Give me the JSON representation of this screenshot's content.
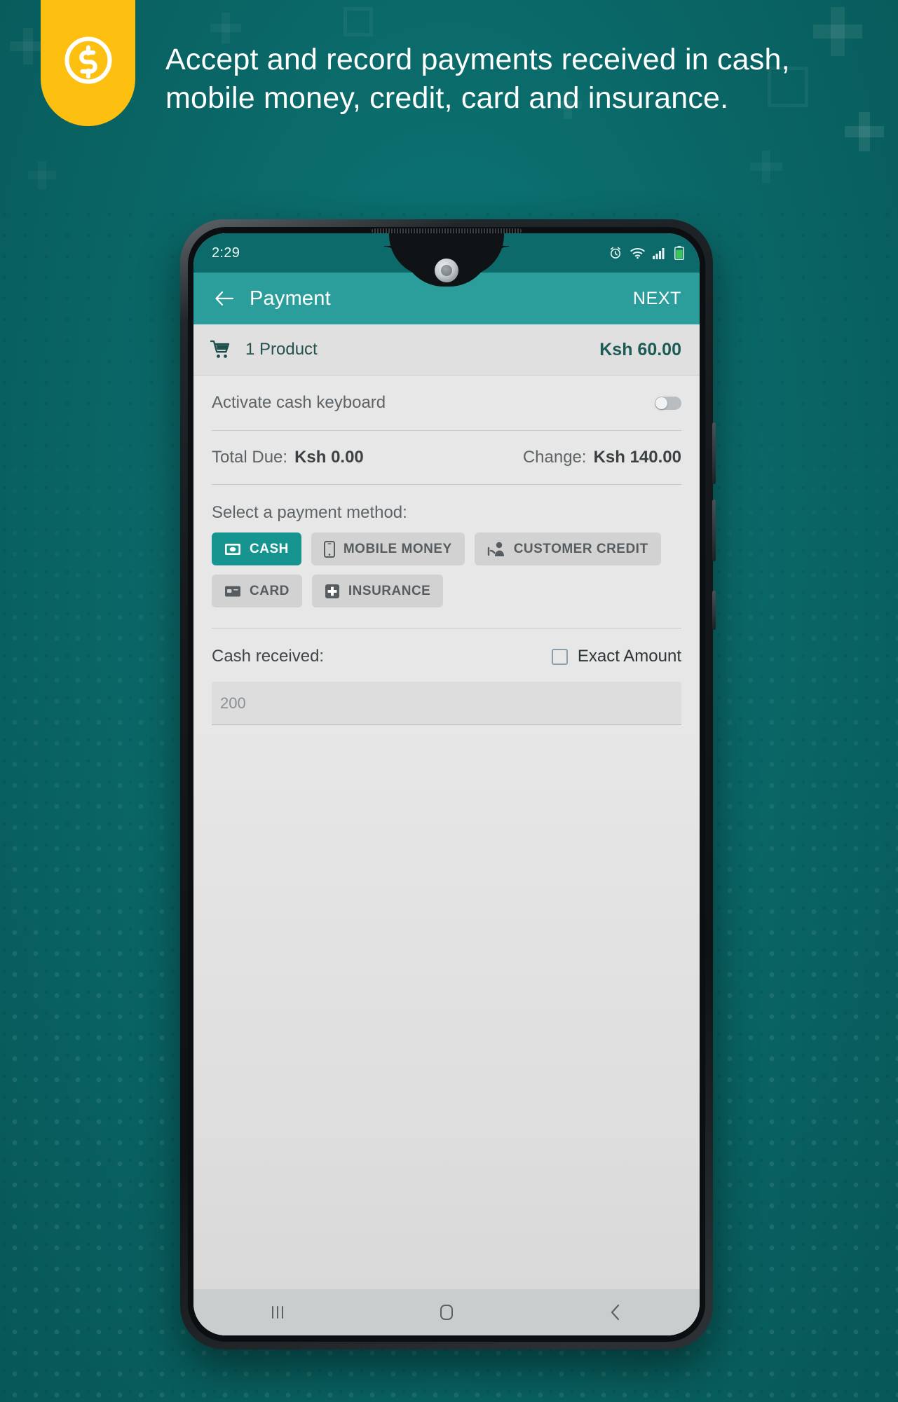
{
  "promo": {
    "headline": "Accept and record payments received in cash, mobile money, credit, card and insurance.",
    "badge_icon": "dollar-coin-icon",
    "colors": {
      "background": "#0b6b6b",
      "badge": "#fdc010",
      "text": "#ffffff"
    }
  },
  "phone": {
    "statusbar": {
      "time": "2:29",
      "icons": [
        "alarm-icon",
        "wifi-icon",
        "signal-icon",
        "battery-icon"
      ],
      "background": "#0c6a6a"
    },
    "appbar": {
      "back_icon": "arrow-left-icon",
      "title": "Payment",
      "next_label": "NEXT",
      "background": "#2b9e9c"
    },
    "product_row": {
      "cart_icon": "shopping-cart-icon",
      "label": "1 Product",
      "total": "Ksh 60.00"
    },
    "cash_keyboard": {
      "label": "Activate cash keyboard",
      "toggle_state": "off"
    },
    "totals": {
      "due_label": "Total Due:",
      "due_value": "Ksh 0.00",
      "change_label": "Change:",
      "change_value": "Ksh 140.00"
    },
    "payment_methods": {
      "section_label": "Select a payment method:",
      "selected": "CASH",
      "selected_color": "#159490",
      "items": [
        {
          "label": "CASH",
          "icon": "money-note-icon",
          "selected": true
        },
        {
          "label": "MOBILE MONEY",
          "icon": "phone-icon",
          "selected": false
        },
        {
          "label": "CUSTOMER CREDIT",
          "icon": "hand-person-icon",
          "selected": false
        },
        {
          "label": "CARD",
          "icon": "credit-card-icon",
          "selected": false
        },
        {
          "label": "INSURANCE",
          "icon": "medical-cross-icon",
          "selected": false
        }
      ]
    },
    "cash_received": {
      "label": "Cash received:",
      "exact_amount_label": "Exact Amount",
      "exact_amount_checked": false,
      "input_value": "200",
      "input_placeholder": "200"
    },
    "navbar": {
      "recents_icon": "recents-icon",
      "home_icon": "home-icon",
      "back_icon": "nav-back-icon"
    }
  }
}
